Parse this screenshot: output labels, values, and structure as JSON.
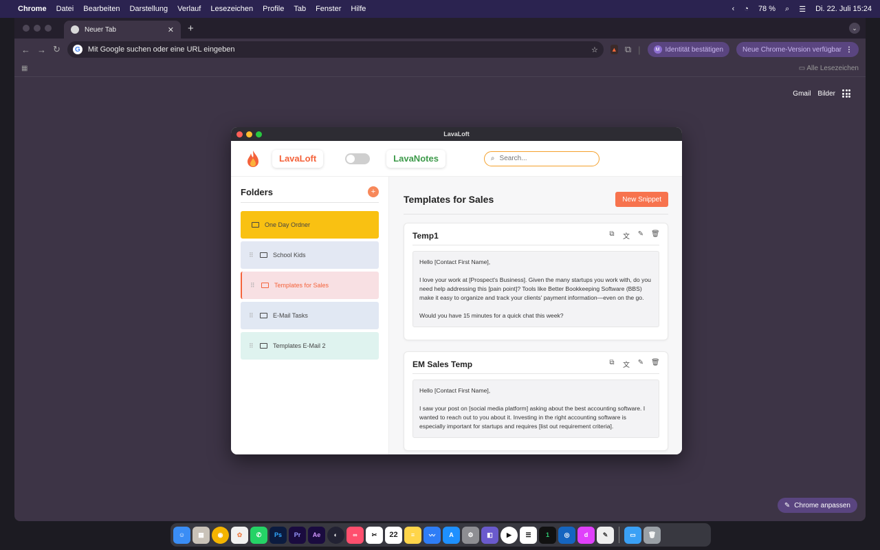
{
  "menubar": {
    "app": "Chrome",
    "items": [
      "Datei",
      "Bearbeiten",
      "Darstellung",
      "Verlauf",
      "Lesezeichen",
      "Profile",
      "Tab",
      "Fenster",
      "Hilfe"
    ],
    "battery": "78 %",
    "datetime": "Di. 22. Juli 15:24"
  },
  "browser": {
    "tab_title": "Neuer Tab",
    "omnibox_placeholder": "Mit Google suchen oder eine URL eingeben",
    "identity_pill": "Identität bestätigen",
    "update_pill": "Neue Chrome-Version verfügbar",
    "bookmarks_all": "Alle Lesezeichen",
    "ntp_gmail": "Gmail",
    "ntp_images": "Bilder",
    "customize": "Chrome anpassen"
  },
  "app": {
    "window_title": "LavaLoft",
    "brand": "LavaLoft",
    "notes_brand": "LavaNotes",
    "search_placeholder": "Search...",
    "sidebar": {
      "title": "Folders",
      "add_label": "+",
      "folders": [
        {
          "label": "One Day Ordner",
          "bg": "#f9c112"
        },
        {
          "label": "School Kids",
          "bg": "#e3e8f3"
        },
        {
          "label": "Templates for Sales",
          "bg": "#f8e0e3"
        },
        {
          "label": "E-Mail Tasks",
          "bg": "#e1e8f3"
        },
        {
          "label": "Templates E-Mail 2",
          "bg": "#dff3ef"
        }
      ]
    },
    "main": {
      "title": "Templates for Sales",
      "new_snippet": "New Snippet",
      "snippets": [
        {
          "title": "Temp1",
          "paragraphs": [
            "Hello [Contact First Name],",
            "I love your work at [Prospect's Business]. Given the many startups you work with, do you need help addressing this [pain point]? Tools like Better Bookkeeping Software (BBS) make it easy to organize and track your clients' payment information—even on the go.",
            "Would you have 15 minutes for a quick chat this week?"
          ]
        },
        {
          "title": "EM Sales Temp",
          "paragraphs": [
            "Hello [Contact First Name],",
            "I saw your post on [social media platform] asking about the best accounting software. I wanted to reach out to you about it. Investing in the right accounting software is especially important for startups and requires [list out requirement criteria]."
          ]
        }
      ]
    }
  },
  "dock": {
    "calendar_day": "22",
    "ps": "Ps",
    "pr": "Pr",
    "ae": "Ae"
  }
}
